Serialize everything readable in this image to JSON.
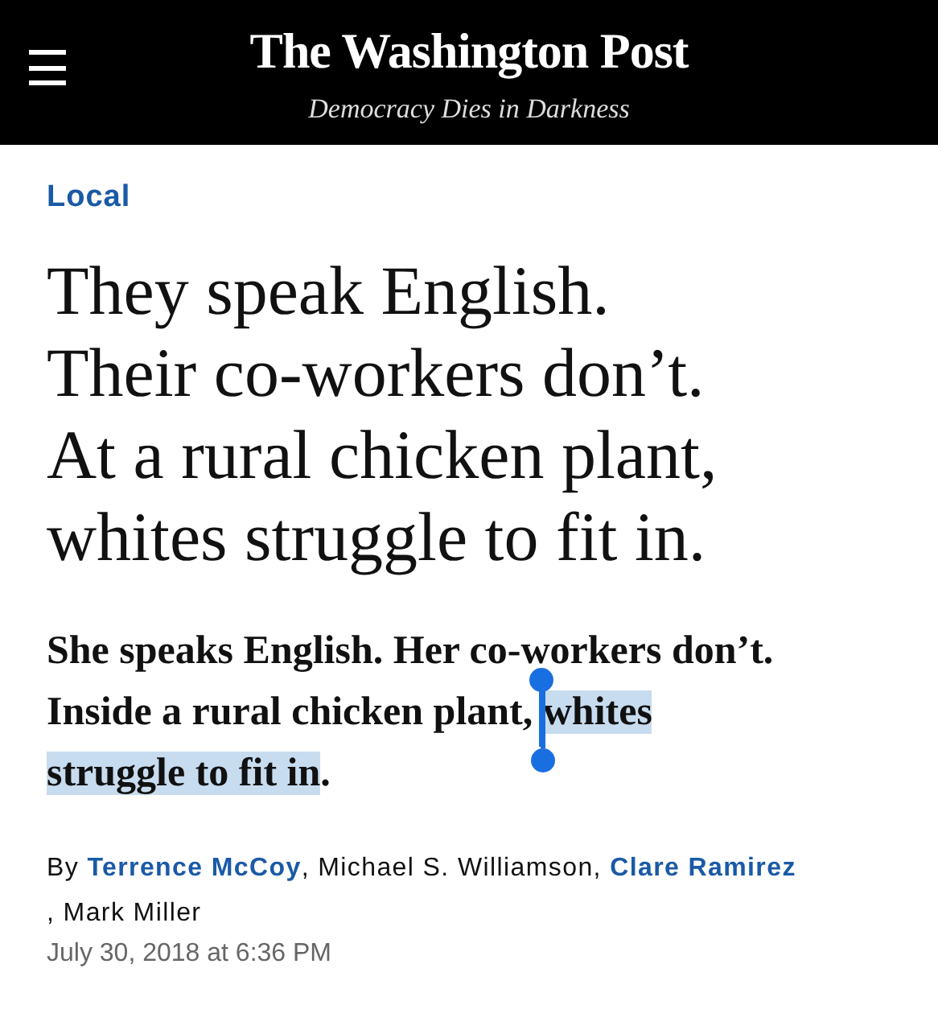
{
  "header": {
    "logo": "The Washington Post",
    "tagline": "Democracy Dies in Darkness"
  },
  "section": "Local",
  "headline": "They speak English.\nTheir co-workers don’t.\nAt a rural chicken plant,\nwhites struggle to fit in.",
  "subheadline": [
    {
      "text": "She speaks English. Her co-workers don’t. Inside a rural chicken plant, ",
      "selected": false
    },
    {
      "text": "whites struggle to fit in",
      "selected": true
    },
    {
      "text": ".",
      "selected": false
    }
  ],
  "byline": [
    {
      "kind": "text",
      "text": "By "
    },
    {
      "kind": "link",
      "text": "Terrence McCoy"
    },
    {
      "kind": "text",
      "text": ", Michael S. Williamson, "
    },
    {
      "kind": "link",
      "text": "Clare Ramirez"
    },
    {
      "kind": "text",
      "text": ", Mark Miller"
    }
  ],
  "date": "July 30, 2018 at 6:36 PM"
}
